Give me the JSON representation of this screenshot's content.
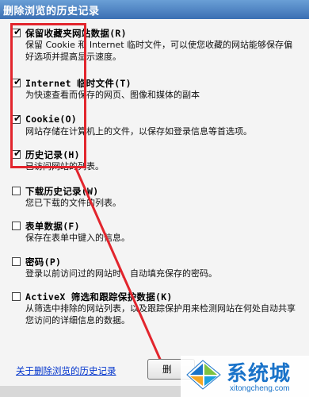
{
  "window": {
    "title": "删除浏览的历史记录"
  },
  "options": [
    {
      "label": "保留收藏夹网站数据(R)",
      "desc": "保留 Cookie 和 Internet 临时文件，可以使您收藏的网站能够保存偏好选项并提高显示速度。",
      "checked": true
    },
    {
      "label": "Internet 临时文件(T)",
      "desc": "为快速查看而保存的网页、图像和媒体的副本",
      "checked": true
    },
    {
      "label": "Cookie(O)",
      "desc": "网站存储在计算机上的文件，以保存如登录信息等首选项。",
      "checked": true
    },
    {
      "label": "历史记录(H)",
      "desc": "已访问网站的列表。",
      "checked": true
    },
    {
      "label": "下载历史记录(W)",
      "desc": "您已下载的文件的列表。",
      "checked": false
    },
    {
      "label": "表单数据(F)",
      "desc": "保存在表单中键入的信息。",
      "checked": false
    },
    {
      "label": "密码(P)",
      "desc": "登录以前访问过的网站时，自动填充保存的密码。",
      "checked": false
    },
    {
      "label": "ActiveX 筛选和跟踪保护数据(K)",
      "desc": "从筛选中排除的网站列表，以及跟踪保护用来检测网站在何处自动共享您访问的详细信息的数据。",
      "checked": false
    }
  ],
  "footer": {
    "link": "关于删除浏览的历史记录",
    "delete_button": "删"
  },
  "watermark": {
    "text": "系统城",
    "url": "xitongcheng.com"
  },
  "colors": {
    "annotation": "#e2252d",
    "link": "#0033cc",
    "titlebar": "#3b6fb3"
  }
}
